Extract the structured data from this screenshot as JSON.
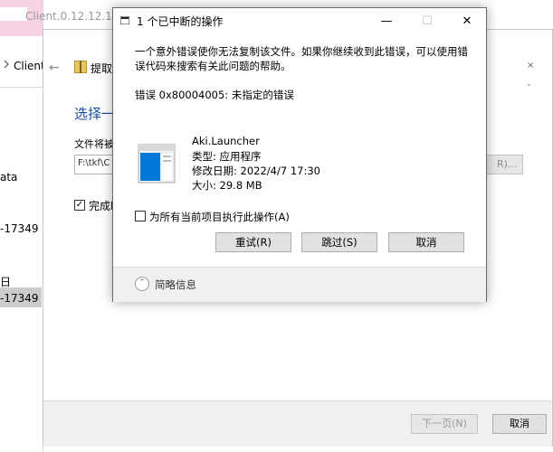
{
  "explorer": {
    "items": [
      "Client",
      "ata",
      "-17349",
      "日",
      "-17349"
    ]
  },
  "wizard": {
    "title": "Client.0.12.12.15.1",
    "back_icon": "back-arrow-icon",
    "breadcrumb": "提取",
    "heading": "选择一",
    "label": "文件将被",
    "path_value": "F:\\tkf\\C",
    "browse_label": "R)...",
    "checkbox_label": "完成时",
    "next_label": "下一页(N)",
    "cancel_label": "取消",
    "right_frag_1": "×",
    "right_frag_2": "ˇ"
  },
  "dialog": {
    "title": "1 个已中断的操作",
    "minimize": "—",
    "maximize": "☐",
    "close": "✕",
    "message": "一个意外错误使你无法复制该文件。如果你继续收到此错误，可以使用错\n误代码来搜索有关此问题的帮助。",
    "error_line": "错误 0x80004005: 未指定的错误",
    "file": {
      "name": "Aki.Launcher",
      "type": "类型: 应用程序",
      "modified": "修改日期: 2022/4/7 17:30",
      "size": "大小: 29.8 MB"
    },
    "apply_all_label": "为所有当前项目执行此操作(A)",
    "buttons": {
      "retry": "重试(R)",
      "skip": "跳过(S)",
      "cancel": "取消"
    },
    "collapse_label": "简略信息",
    "colors": {
      "accent": "#0078d7",
      "border": "#6b6b6b"
    }
  }
}
